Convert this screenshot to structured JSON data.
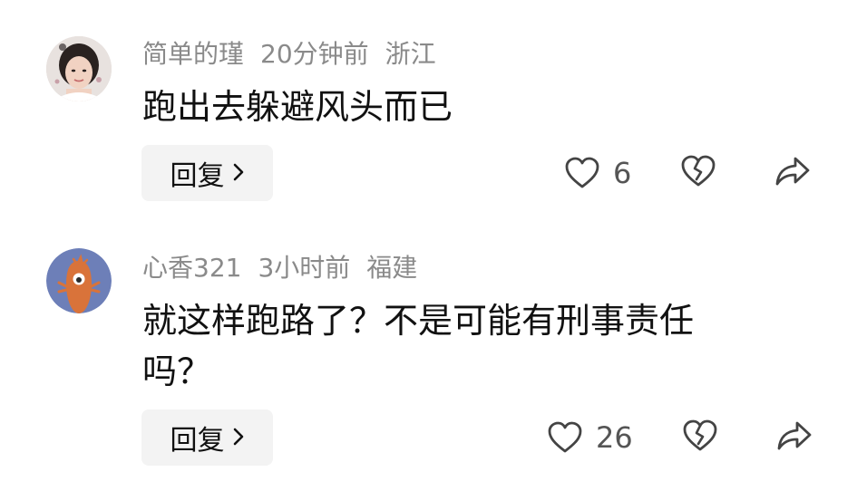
{
  "comments": [
    {
      "username": "简单的瑾",
      "time": "20分钟前",
      "location": "浙江",
      "text": "跑出去躲避风头而已",
      "reply_label": "回复",
      "like_count": "6",
      "avatar": "woman-photo-avatar"
    },
    {
      "username": "心香321",
      "time": "3小时前",
      "location": "福建",
      "text": "就这样跑路了？不是可能有刑事责任吗？",
      "reply_label": "回复",
      "like_count": "26",
      "avatar": "cartoon-character-avatar"
    }
  ],
  "icons": {
    "like": "heart-outline-icon",
    "dislike": "broken-heart-icon",
    "share": "share-arrow-icon",
    "reply_chevron": "chevron-right-icon"
  },
  "colors": {
    "meta_text": "#8a8a8a",
    "reply_bg": "#f3f3f3",
    "icon_stroke": "#444444",
    "avatar2_bg": "#6d7fb8",
    "avatar2_figure": "#d9733a"
  }
}
